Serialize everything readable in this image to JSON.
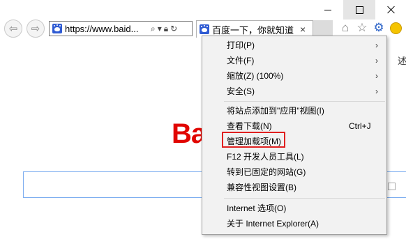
{
  "navbar": {
    "url": "https://www.baid...",
    "tab_title": "百度一下，你就知道"
  },
  "page": {
    "logo_text": "Ba",
    "edge_text": "述"
  },
  "menu": {
    "items": [
      {
        "label": "打印(P)",
        "shortcut": "",
        "submenu": "›"
      },
      {
        "label": "文件(F)",
        "shortcut": "",
        "submenu": "›"
      },
      {
        "label": "缩放(Z) (100%)",
        "shortcut": "",
        "submenu": "›"
      },
      {
        "label": "安全(S)",
        "shortcut": "",
        "submenu": "›"
      },
      {
        "label": "将站点添加到\"应用\"视图(I)",
        "shortcut": "",
        "submenu": ""
      },
      {
        "label": "查看下载(N)",
        "shortcut": "Ctrl+J",
        "submenu": ""
      },
      {
        "label": "管理加载项(M)",
        "shortcut": "",
        "submenu": ""
      },
      {
        "label": "F12 开发人员工具(L)",
        "shortcut": "",
        "submenu": ""
      },
      {
        "label": "转到已固定的网站(G)",
        "shortcut": "",
        "submenu": ""
      },
      {
        "label": "兼容性视图设置(B)",
        "shortcut": "",
        "submenu": ""
      },
      {
        "label": "Internet 选项(O)",
        "shortcut": "",
        "submenu": ""
      },
      {
        "label": "关于 Internet Explorer(A)",
        "shortcut": "",
        "submenu": ""
      }
    ]
  },
  "colors": {
    "accent_blue": "#2a62c8",
    "logo_red": "#e10601",
    "highlight_box": "#e02020"
  }
}
